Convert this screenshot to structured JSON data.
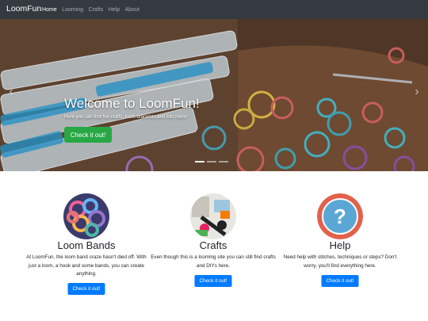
{
  "navbar": {
    "brand": "LoomFun",
    "links": [
      {
        "label": "Home",
        "active": true
      },
      {
        "label": "Looming",
        "active": false
      },
      {
        "label": "Crafts",
        "active": false
      },
      {
        "label": "Help",
        "active": false
      },
      {
        "label": "About",
        "active": false
      }
    ]
  },
  "carousel": {
    "title": "Welcome to LoomFun!",
    "subtitle": "Here you can find fun crafts, loom bracelets and lots more!",
    "button": "Check it out!",
    "slide_count": 3,
    "active_slide": 1
  },
  "features": [
    {
      "title": "Loom Bands",
      "text": "At LoomFun, the loom band craze hasn't died off. With just a loom, a hook and some bands, you can create anything.",
      "button": "Check it out!",
      "image_icon": "loom-bands-photo"
    },
    {
      "title": "Crafts",
      "text": "Even though this is a looming site you can still find crafts and DIYs here.",
      "button": "Check it out!",
      "image_icon": "crafts-photo"
    },
    {
      "title": "Help",
      "text": "Need help with stitches, techniques or steps? Don't worry, you'll find everything here.",
      "button": "Check it out!",
      "image_icon": "question-mark-icon"
    }
  ],
  "colors": {
    "navbar": "#343a40",
    "hero_button": "#28a745",
    "primary": "#007bff",
    "help_ring": "#e2614b",
    "help_fill": "#5aa7d6"
  }
}
